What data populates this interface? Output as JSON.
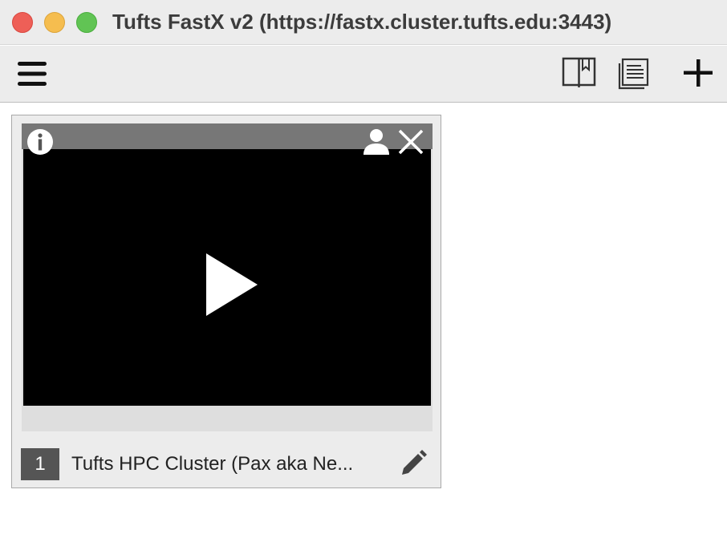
{
  "window": {
    "title": "Tufts FastX v2 (https://fastx.cluster.tufts.edu:3443)"
  },
  "toolbar": {
    "icons": [
      "hamburger-menu-icon",
      "bookmarks-icon",
      "log-document-icon",
      "plus-icon"
    ]
  },
  "sessions": [
    {
      "number": "1",
      "name": "Tufts HPC Cluster (Pax aka Ne..."
    }
  ],
  "colors": {
    "titlebar": "#ececec",
    "close": "#ee5f57",
    "minimize": "#f5bd4f",
    "maximize": "#61c454",
    "thumbnail_header": "#777777",
    "badge": "#555555"
  }
}
